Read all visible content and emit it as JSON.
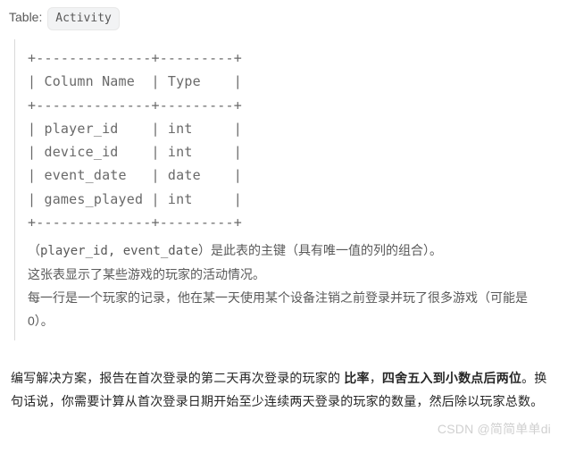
{
  "intro": {
    "label": "Table:",
    "tableName": "Activity"
  },
  "ascii": {
    "border": "+--------------+---------+",
    "header": "| Column Name  | Type    |",
    "rows": [
      "| player_id    | int     |",
      "| device_id    | int     |",
      "| event_date   | date    |",
      "| games_played | int     |"
    ]
  },
  "desc": {
    "line1_pre": "（",
    "line1_code": "player_id, event_date",
    "line1_post": "）是此表的主键（具有唯一值的列的组合）。",
    "line2": "这张表显示了某些游戏的玩家的活动情况。",
    "line3": "每一行是一个玩家的记录，他在某一天使用某个设备注销之前登录并玩了很多游戏（可能是 0）。"
  },
  "task": {
    "p1_a": "编写解决方案，报告在首次登录的第二天再次登录的玩家的 ",
    "p1_b_strong": "比率",
    "p1_c": "，",
    "p1_d_strong": "四舍五入到小数点后两位",
    "p1_e": "。换句话说，你需要计算从首次登录日期开始至少连续两天登录的玩家的数量，然后除以玩家总数。"
  },
  "watermark": "CSDN @简简单单di"
}
